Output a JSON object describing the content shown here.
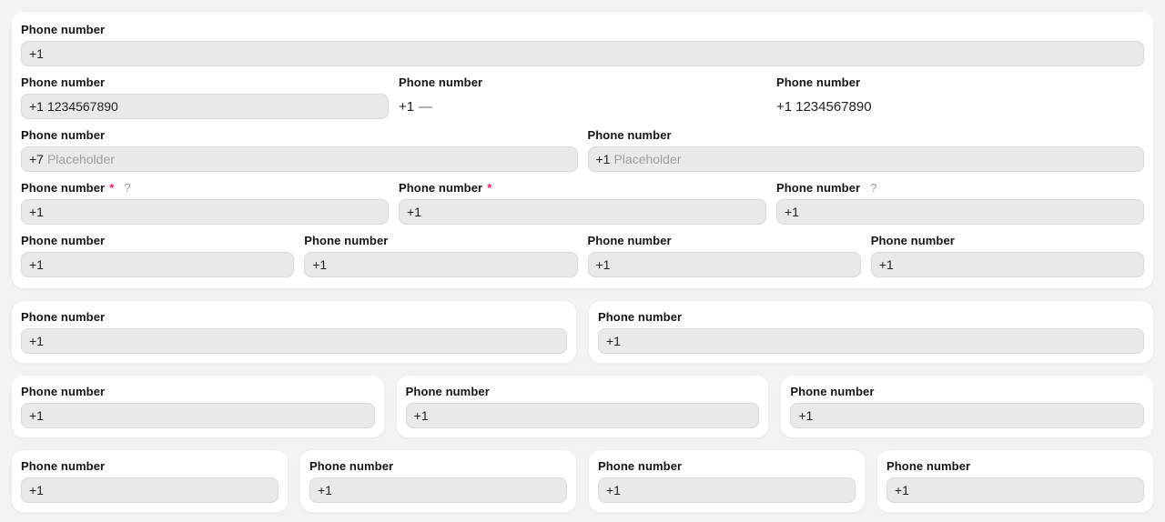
{
  "colors": {
    "page_bg": "#f2f3f5",
    "card_bg": "#ffffff",
    "input_bg": "#e9e9e9",
    "input_border": "#d9d9d9",
    "required_marker": "#e91e63",
    "help_icon": "#9e9e9e",
    "placeholder_text": "#9aa0a6"
  },
  "main_card": {
    "row1": {
      "field": {
        "label": "Phone number",
        "prefix": "+1"
      }
    },
    "row2": {
      "col1": {
        "label": "Phone number",
        "prefix": "+1",
        "value": "1234567890"
      },
      "col2": {
        "label": "Phone number",
        "prefix": "+1",
        "dash": "—"
      },
      "col3": {
        "label": "Phone number",
        "prefix": "+1",
        "value": "1234567890"
      }
    },
    "row3": {
      "col1": {
        "label": "Phone number",
        "prefix": "+7",
        "placeholder": "Placeholder"
      },
      "col2": {
        "label": "Phone number",
        "prefix": "+1",
        "placeholder": "Placeholder"
      }
    },
    "row4": {
      "col1": {
        "label": "Phone number",
        "required": "*",
        "help": "?",
        "prefix": "+1"
      },
      "col2": {
        "label": "Phone number",
        "required": "*",
        "prefix": "+1"
      },
      "col3": {
        "label": "Phone number",
        "help": "?",
        "prefix": "+1"
      }
    },
    "row5": {
      "col1": {
        "label": "Phone number",
        "prefix": "+1"
      },
      "col2": {
        "label": "Phone number",
        "prefix": "+1"
      },
      "col3": {
        "label": "Phone number",
        "prefix": "+1"
      },
      "col4": {
        "label": "Phone number",
        "prefix": "+1"
      }
    }
  },
  "section_two": {
    "card1": {
      "label": "Phone number",
      "prefix": "+1"
    },
    "card2": {
      "label": "Phone number",
      "prefix": "+1"
    }
  },
  "section_three": {
    "card1": {
      "label": "Phone number",
      "prefix": "+1"
    },
    "card2": {
      "label": "Phone number",
      "prefix": "+1"
    },
    "card3": {
      "label": "Phone number",
      "prefix": "+1"
    }
  },
  "section_four": {
    "card1": {
      "label": "Phone number",
      "prefix": "+1"
    },
    "card2": {
      "label": "Phone number",
      "prefix": "+1"
    },
    "card3": {
      "label": "Phone number",
      "prefix": "+1"
    },
    "card4": {
      "label": "Phone number",
      "prefix": "+1"
    }
  }
}
